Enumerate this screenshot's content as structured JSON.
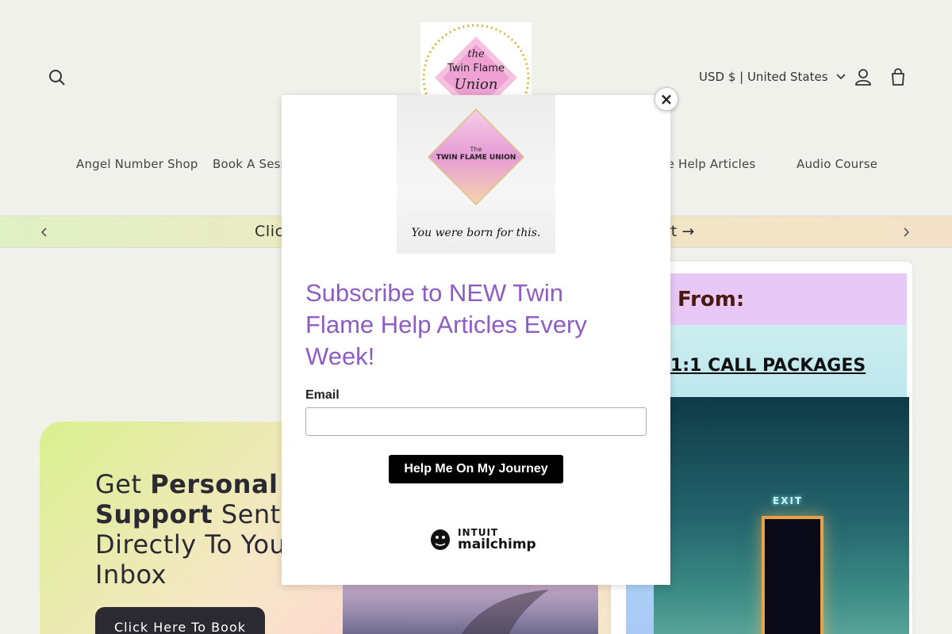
{
  "header": {
    "logo_text": [
      "the",
      "Twin Flame",
      "Union"
    ],
    "currency": "USD $ | United States",
    "nav": [
      "Angel Number Shop",
      "Book A Sess",
      "lame Help Articles",
      "Audio Course"
    ]
  },
  "announcement": {
    "text_start": "Clic",
    "text_end": "rt"
  },
  "hero": {
    "title_pre": "Get ",
    "title_bold": "Personal Support",
    "title_post": " Sent Directly To Your Inbox",
    "button": "Click Here To Book"
  },
  "promo": {
    "heading": "From:",
    "cta": "1:1 CALL PACKAGES",
    "exit_label": "EXIT"
  },
  "modal": {
    "image_brand_top": "The",
    "image_brand": "TWIN FLAME UNION",
    "image_tagline": "You were born for this.",
    "heading": "Subscribe to NEW Twin Flame Help Articles Every Week!",
    "email_label": "Email",
    "email_value": "",
    "submit": "Help Me On My Journey",
    "close": "×",
    "mailchimp_top": "INTUIT",
    "mailchimp_name": "mailchimp"
  }
}
